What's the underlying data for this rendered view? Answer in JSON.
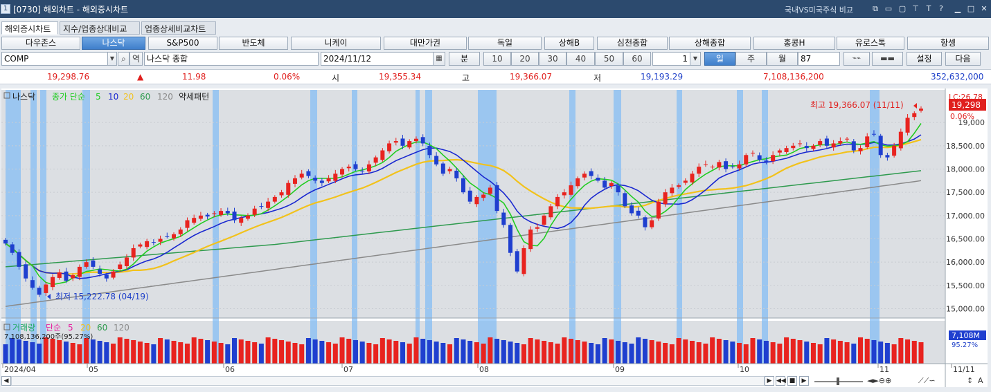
{
  "title": {
    "number": "1",
    "text": "[0730] 해외차트 - 해외증시차트",
    "right_label": "국내VS미국주식 비교"
  },
  "tabs": [
    "해외증시차트",
    "지수/업종상대비교",
    "업종상세비교차트"
  ],
  "markets": [
    "다우존스",
    "나스닥",
    "S&P500",
    "반도체",
    "니케이",
    "대만가권",
    "독일",
    "상해B",
    "심천종합",
    "상해종합",
    "홍콩H",
    "유로스톡",
    "항셍"
  ],
  "options": {
    "code": "COMP",
    "name_btn": "역",
    "name": "나스닥 종합",
    "date": "2024/11/12",
    "unit": "분",
    "minutes": [
      "10",
      "20",
      "30",
      "40",
      "50",
      "60"
    ],
    "count": "1",
    "periods": [
      "일",
      "주",
      "월"
    ],
    "period_value": "87",
    "settings": "설정",
    "next": "다음"
  },
  "quote": {
    "price": "19,298.76",
    "change_arrow": "▲",
    "change": "11.98",
    "change_pct": "0.06%",
    "open_label": "시",
    "open": "19,355.34",
    "high_label": "고",
    "high": "19,366.07",
    "low_label": "저",
    "low": "19,193.29",
    "volume": "7,108,136,200",
    "amount": "352,632,000"
  },
  "legend": {
    "name": "나스닥",
    "ma_label": "종가 단순",
    "ma": [
      "5",
      "10",
      "20",
      "60",
      "120"
    ],
    "pattern": "약세패턴",
    "vol_label": "거래량",
    "vol_ma_label": "단순",
    "vol_ma": [
      "5",
      "20",
      "60",
      "120"
    ],
    "vol_value": "7,108,136,200주(95.27%)"
  },
  "annotations": {
    "high": "최고 19,366.07 (11/11)",
    "low": "최저 15,222.78 (04/19)",
    "top_right": "LC:26.78",
    "price_badge": "19,298",
    "pct_badge": "0.06%",
    "vol_badge": "7,108M",
    "vol_pct": "95.27%"
  },
  "x_labels": [
    "2024/04",
    "05",
    "06",
    "07",
    "08",
    "09",
    "10",
    "11",
    "11/11"
  ],
  "colors": {
    "up": "#e8231f",
    "down": "#1f3fcf",
    "ma5": "#22cc22",
    "ma10": "#1a28d0",
    "ma20": "#f2c21b",
    "ma60": "#2e9a4e",
    "ma120": "#8a8a8a",
    "highlight": "#86bdf4"
  },
  "chart_data": {
    "type": "candlestick",
    "title": "나스닥",
    "ylim": [
      14800,
      19700
    ],
    "yticks": [
      15000,
      15500,
      16000,
      16500,
      17000,
      17500,
      18000,
      18500,
      19000
    ],
    "ytick_labels": [
      "15,000.00",
      "15,500.00",
      "16,000.00",
      "16,500.00",
      "17,000.00",
      "17,500.00",
      "18,000.00",
      "18,500.00",
      "19,000"
    ],
    "series_close": [
      16400,
      16200,
      15900,
      15650,
      15450,
      15300,
      15520,
      15680,
      15780,
      15600,
      15720,
      15900,
      16000,
      15900,
      15750,
      15650,
      15800,
      15950,
      16100,
      16300,
      16380,
      16450,
      16420,
      16500,
      16550,
      16600,
      16700,
      16900,
      16950,
      17000,
      16980,
      17050,
      17100,
      17050,
      16900,
      16950,
      17000,
      17150,
      17200,
      17300,
      17400,
      17500,
      17700,
      17800,
      17900,
      17850,
      17750,
      17700,
      17800,
      17900,
      18000,
      18050,
      18000,
      17950,
      18100,
      18250,
      18400,
      18550,
      18600,
      18500,
      18600,
      18650,
      18550,
      18300,
      18100,
      17900,
      18000,
      17800,
      17500,
      17300,
      17400,
      17450,
      17600,
      17100,
      16800,
      16200,
      15800,
      16300,
      16700,
      16750,
      17000,
      17200,
      17400,
      17500,
      17650,
      17800,
      17900,
      17850,
      17750,
      17600,
      17700,
      17500,
      17200,
      17050,
      17000,
      16750,
      16900,
      17300,
      17500,
      17600,
      17650,
      17750,
      17900,
      18050,
      18100,
      18050,
      18150,
      18000,
      18050,
      18100,
      18300,
      18350,
      18200,
      18150,
      18300,
      18400,
      18450,
      18500,
      18550,
      18450,
      18500,
      18600,
      18500,
      18550,
      18600,
      18650,
      18400,
      18450,
      18700,
      18750,
      18300,
      18250,
      18500,
      18800,
      19100,
      19200,
      19298
    ]
  }
}
